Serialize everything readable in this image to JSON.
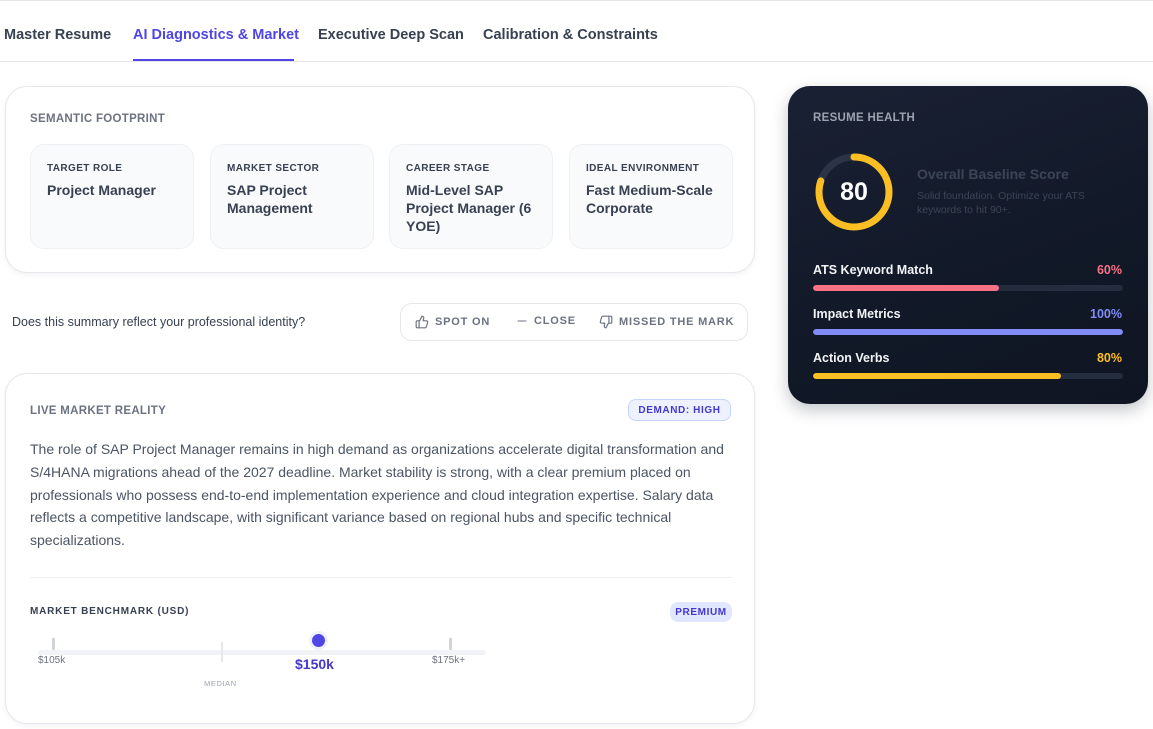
{
  "tabs": [
    {
      "label": "Master Resume",
      "active": false
    },
    {
      "label": "AI Diagnostics & Market",
      "active": true
    },
    {
      "label": "Executive Deep Scan",
      "active": false
    },
    {
      "label": "Calibration & Constraints",
      "active": false
    }
  ],
  "footprint": {
    "title": "SEMANTIC FOOTPRINT",
    "tiles": [
      {
        "label": "TARGET ROLE",
        "value": "Project Manager"
      },
      {
        "label": "MARKET SECTOR",
        "value": "SAP Project Management"
      },
      {
        "label": "CAREER STAGE",
        "value": "Mid-Level SAP Project Manager (6 YOE)"
      },
      {
        "label": "IDEAL ENVIRONMENT",
        "value": "Fast Medium-Scale Corporate"
      }
    ]
  },
  "feedback": {
    "question": "Does this summary reflect your professional identity?",
    "spot_on": "SPOT ON",
    "close": "CLOSE",
    "missed": "MISSED THE MARK"
  },
  "market": {
    "title": "LIVE MARKET REALITY",
    "demand_badge": "DEMAND: HIGH",
    "description": "The role of SAP Project Manager remains in high demand as organizations accelerate digital transformation and S/4HANA migrations ahead of the 2027 deadline. Market stability is strong, with a clear premium placed on professionals who possess end-to-end implementation experience and cloud integration expertise. Salary data reflects a competitive landscape, with significant variance based on regional hubs and specific technical specializations.",
    "benchmark_label": "MARKET BENCHMARK (USD)",
    "premium_badge": "PREMIUM",
    "low_label": "$105k",
    "median_label": "MEDIAN",
    "current_label": "$150k",
    "high_label": "$175k+"
  },
  "health": {
    "title": "RESUME HEALTH",
    "score": 80,
    "score_text": "80",
    "score_title": "Overall Baseline Score",
    "score_sub": "Solid foundation. Optimize your ATS keywords to hit 90+.",
    "ring_color": "#fbbf24",
    "metrics": [
      {
        "label": "ATS Keyword Match",
        "value_text": "60%",
        "value": 60,
        "color": "#f87185"
      },
      {
        "label": "Impact Metrics",
        "value_text": "100%",
        "value": 100,
        "color": "#818cf8"
      },
      {
        "label": "Action Verbs",
        "value_text": "80%",
        "value": 80,
        "color": "#fbbf24"
      }
    ]
  }
}
